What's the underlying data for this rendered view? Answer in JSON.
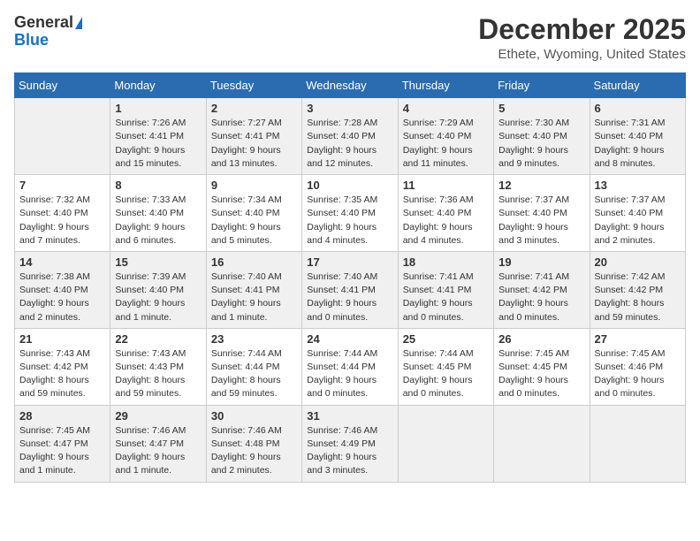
{
  "logo": {
    "general": "General",
    "blue": "Blue"
  },
  "header": {
    "month": "December 2025",
    "location": "Ethete, Wyoming, United States"
  },
  "weekdays": [
    "Sunday",
    "Monday",
    "Tuesday",
    "Wednesday",
    "Thursday",
    "Friday",
    "Saturday"
  ],
  "weeks": [
    [
      {
        "day": "",
        "empty": true
      },
      {
        "day": "1",
        "sunrise": "7:26 AM",
        "sunset": "4:41 PM",
        "daylight": "9 hours and 15 minutes."
      },
      {
        "day": "2",
        "sunrise": "7:27 AM",
        "sunset": "4:41 PM",
        "daylight": "9 hours and 13 minutes."
      },
      {
        "day": "3",
        "sunrise": "7:28 AM",
        "sunset": "4:40 PM",
        "daylight": "9 hours and 12 minutes."
      },
      {
        "day": "4",
        "sunrise": "7:29 AM",
        "sunset": "4:40 PM",
        "daylight": "9 hours and 11 minutes."
      },
      {
        "day": "5",
        "sunrise": "7:30 AM",
        "sunset": "4:40 PM",
        "daylight": "9 hours and 9 minutes."
      },
      {
        "day": "6",
        "sunrise": "7:31 AM",
        "sunset": "4:40 PM",
        "daylight": "9 hours and 8 minutes."
      }
    ],
    [
      {
        "day": "7",
        "sunrise": "7:32 AM",
        "sunset": "4:40 PM",
        "daylight": "9 hours and 7 minutes."
      },
      {
        "day": "8",
        "sunrise": "7:33 AM",
        "sunset": "4:40 PM",
        "daylight": "9 hours and 6 minutes."
      },
      {
        "day": "9",
        "sunrise": "7:34 AM",
        "sunset": "4:40 PM",
        "daylight": "9 hours and 5 minutes."
      },
      {
        "day": "10",
        "sunrise": "7:35 AM",
        "sunset": "4:40 PM",
        "daylight": "9 hours and 4 minutes."
      },
      {
        "day": "11",
        "sunrise": "7:36 AM",
        "sunset": "4:40 PM",
        "daylight": "9 hours and 4 minutes."
      },
      {
        "day": "12",
        "sunrise": "7:37 AM",
        "sunset": "4:40 PM",
        "daylight": "9 hours and 3 minutes."
      },
      {
        "day": "13",
        "sunrise": "7:37 AM",
        "sunset": "4:40 PM",
        "daylight": "9 hours and 2 minutes."
      }
    ],
    [
      {
        "day": "14",
        "sunrise": "7:38 AM",
        "sunset": "4:40 PM",
        "daylight": "9 hours and 2 minutes."
      },
      {
        "day": "15",
        "sunrise": "7:39 AM",
        "sunset": "4:40 PM",
        "daylight": "9 hours and 1 minute."
      },
      {
        "day": "16",
        "sunrise": "7:40 AM",
        "sunset": "4:41 PM",
        "daylight": "9 hours and 1 minute."
      },
      {
        "day": "17",
        "sunrise": "7:40 AM",
        "sunset": "4:41 PM",
        "daylight": "9 hours and 0 minutes."
      },
      {
        "day": "18",
        "sunrise": "7:41 AM",
        "sunset": "4:41 PM",
        "daylight": "9 hours and 0 minutes."
      },
      {
        "day": "19",
        "sunrise": "7:41 AM",
        "sunset": "4:42 PM",
        "daylight": "9 hours and 0 minutes."
      },
      {
        "day": "20",
        "sunrise": "7:42 AM",
        "sunset": "4:42 PM",
        "daylight": "8 hours and 59 minutes."
      }
    ],
    [
      {
        "day": "21",
        "sunrise": "7:43 AM",
        "sunset": "4:42 PM",
        "daylight": "8 hours and 59 minutes."
      },
      {
        "day": "22",
        "sunrise": "7:43 AM",
        "sunset": "4:43 PM",
        "daylight": "8 hours and 59 minutes."
      },
      {
        "day": "23",
        "sunrise": "7:44 AM",
        "sunset": "4:44 PM",
        "daylight": "8 hours and 59 minutes."
      },
      {
        "day": "24",
        "sunrise": "7:44 AM",
        "sunset": "4:44 PM",
        "daylight": "9 hours and 0 minutes."
      },
      {
        "day": "25",
        "sunrise": "7:44 AM",
        "sunset": "4:45 PM",
        "daylight": "9 hours and 0 minutes."
      },
      {
        "day": "26",
        "sunrise": "7:45 AM",
        "sunset": "4:45 PM",
        "daylight": "9 hours and 0 minutes."
      },
      {
        "day": "27",
        "sunrise": "7:45 AM",
        "sunset": "4:46 PM",
        "daylight": "9 hours and 0 minutes."
      }
    ],
    [
      {
        "day": "28",
        "sunrise": "7:45 AM",
        "sunset": "4:47 PM",
        "daylight": "9 hours and 1 minute."
      },
      {
        "day": "29",
        "sunrise": "7:46 AM",
        "sunset": "4:47 PM",
        "daylight": "9 hours and 1 minute."
      },
      {
        "day": "30",
        "sunrise": "7:46 AM",
        "sunset": "4:48 PM",
        "daylight": "9 hours and 2 minutes."
      },
      {
        "day": "31",
        "sunrise": "7:46 AM",
        "sunset": "4:49 PM",
        "daylight": "9 hours and 3 minutes."
      },
      {
        "day": "",
        "empty": true
      },
      {
        "day": "",
        "empty": true
      },
      {
        "day": "",
        "empty": true
      }
    ]
  ],
  "labels": {
    "sunrise": "Sunrise:",
    "sunset": "Sunset:",
    "daylight": "Daylight:"
  }
}
